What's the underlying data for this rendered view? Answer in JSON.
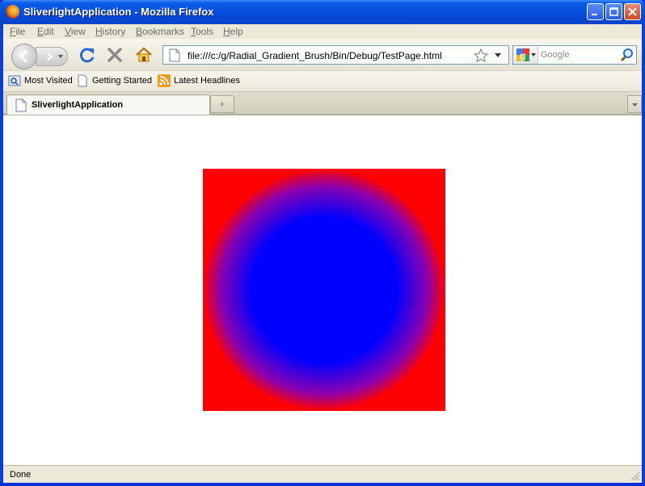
{
  "window": {
    "title": "SliverlightApplication - Mozilla Firefox"
  },
  "menu": [
    "File",
    "Edit",
    "View",
    "History",
    "Bookmarks",
    "Tools",
    "Help"
  ],
  "address": {
    "url": "file:///c:/g/Radial_Gradient_Brush/Bin/Debug/TestPage.html"
  },
  "search": {
    "placeholder": "Google"
  },
  "bookmarks": [
    "Most Visited",
    "Getting Started",
    "Latest Headlines"
  ],
  "tab": {
    "label": "SliverlightApplication"
  },
  "status": {
    "text": "Done"
  },
  "colors": {
    "gradient_center": "#0000ff",
    "gradient_edge": "#ff0000"
  }
}
